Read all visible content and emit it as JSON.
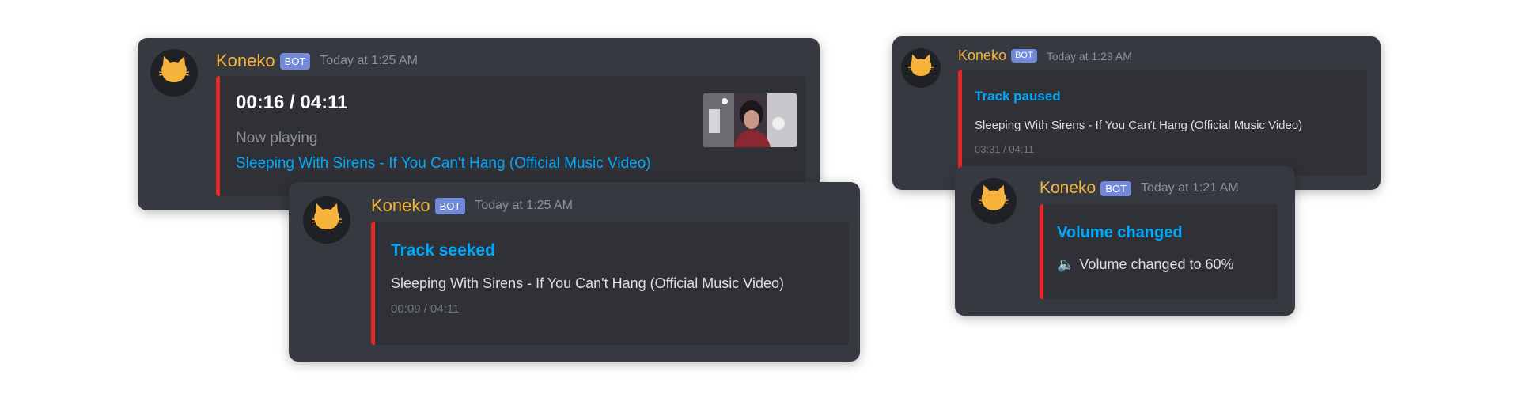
{
  "bot": {
    "username": "Koneko",
    "badge": "BOT"
  },
  "colors": {
    "card": "#36393f",
    "embed": "#2f3136",
    "accent_bar": "#e62727",
    "link": "#00a8fc",
    "username": "#f4b33b",
    "badge": "#7289da"
  },
  "now_playing": {
    "timestamp": "Today at 1:25 AM",
    "progress": "00:16 / 04:11",
    "label": "Now playing",
    "track_link": "Sleeping With Sirens - If You Can't Hang (Official Music Video)",
    "thumbnail": "music-video-thumbnail"
  },
  "track_seeked": {
    "timestamp": "Today at 1:25 AM",
    "title": "Track seeked",
    "track": "Sleeping With Sirens - If You Can't Hang (Official Music Video)",
    "position": "00:09 / 04:11"
  },
  "track_paused": {
    "timestamp": "Today at 1:29 AM",
    "title": "Track paused",
    "track": "Sleeping With Sirens - If You Can't Hang (Official Music Video)",
    "position": "03:31 / 04:11"
  },
  "volume_changed": {
    "timestamp": "Today at 1:21 AM",
    "title": "Volume changed",
    "speaker_icon": "🔈",
    "text": "Volume changed to 60%"
  }
}
